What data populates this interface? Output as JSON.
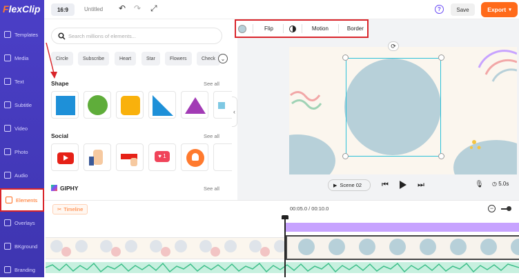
{
  "app": {
    "logo_first": "F",
    "logo_rest": "lexClip"
  },
  "sidebar": {
    "items": [
      {
        "label": "Templates"
      },
      {
        "label": "Media"
      },
      {
        "label": "Text"
      },
      {
        "label": "Subtitle"
      },
      {
        "label": "Video"
      },
      {
        "label": "Photo"
      },
      {
        "label": "Audio"
      },
      {
        "label": "Elements"
      },
      {
        "label": "Overlays"
      },
      {
        "label": "BKground"
      },
      {
        "label": "Branding"
      }
    ]
  },
  "topbar": {
    "ratio": "16:9",
    "title": "Untitled",
    "save": "Save",
    "export": "Export",
    "help": "?"
  },
  "panel": {
    "search_placeholder": "Search millions of elements...",
    "chips": [
      "Circle",
      "Subscribe",
      "Heart",
      "Star",
      "Flowers",
      "Check"
    ],
    "shape_title": "Shape",
    "social_title": "Social",
    "giphy_title": "GIPHY",
    "see_all": "See all"
  },
  "toolbar": {
    "flip": "Flip",
    "motion": "Motion",
    "border": "Border"
  },
  "player": {
    "scene": "Scene 02",
    "duration": "5.0s"
  },
  "timeline": {
    "tag": "Timeline",
    "timecode": "00:05.0 / 00:10.0"
  },
  "colors": {
    "accent": "#ff6a1a",
    "sidebar": "#4b3fc7",
    "shape_fill": "#b7d0d9",
    "highlight": "#d9242a"
  }
}
